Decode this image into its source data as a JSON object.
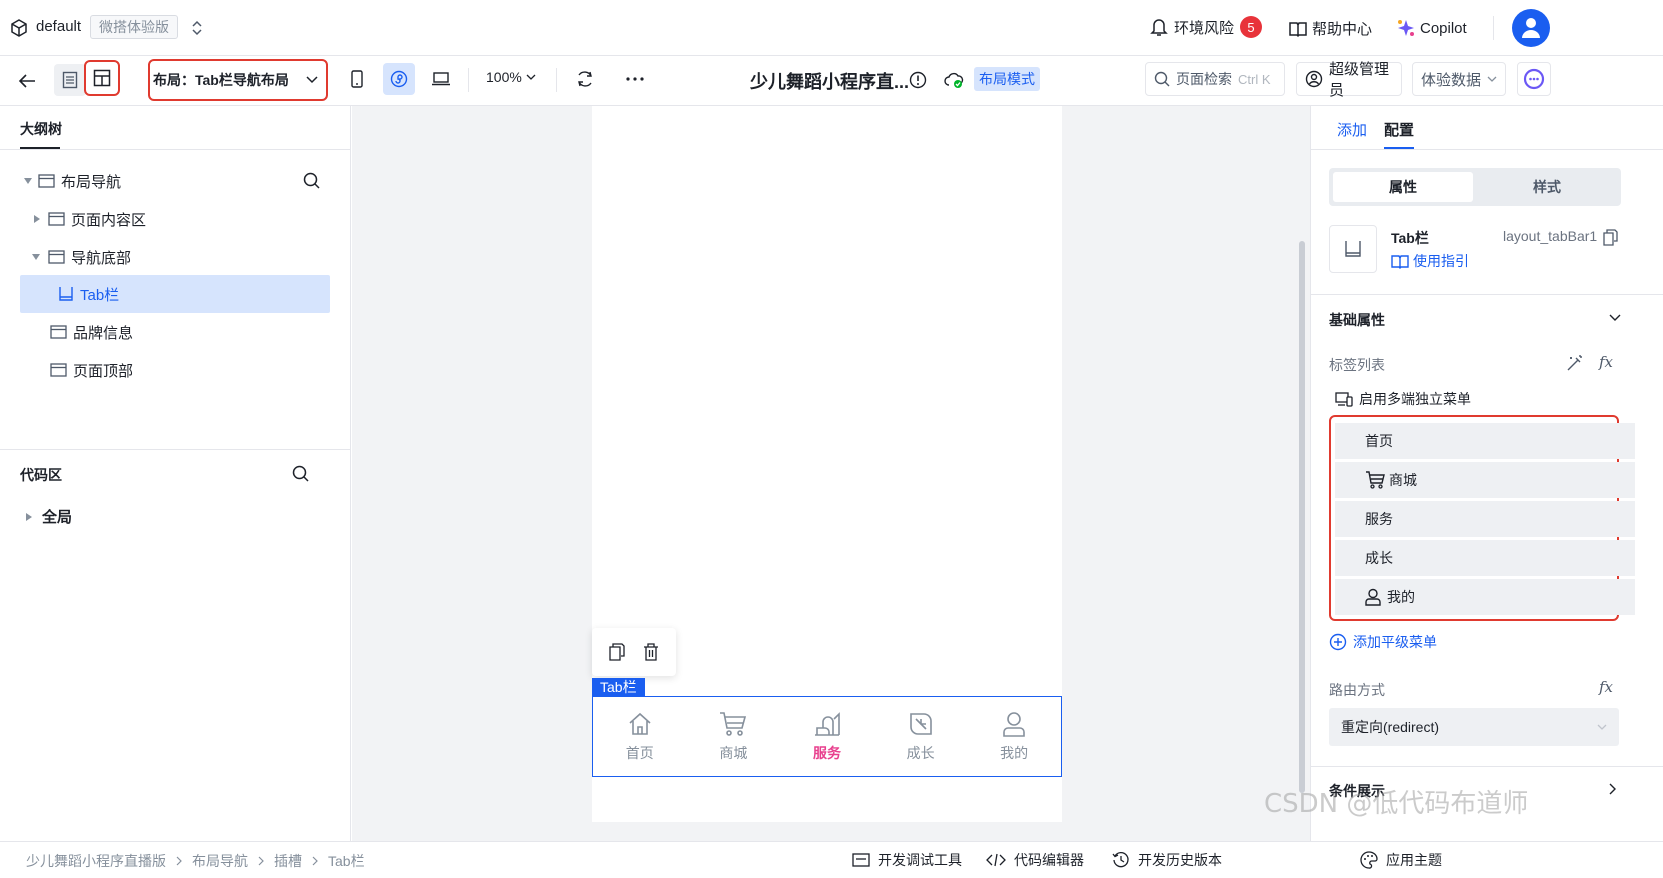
{
  "header": {
    "app_name": "default",
    "edition_badge": "微搭体验版",
    "env_risk_label": "环境风险",
    "env_risk_count": "5",
    "help_label": "帮助中心",
    "copilot_label": "Copilot"
  },
  "toolbar": {
    "layout_select": "布局：Tab栏导航布局",
    "zoom": "100%",
    "page_title": "少儿舞蹈小程序直...",
    "layout_mode_badge": "布局模式",
    "search_label": "页面检索",
    "search_shortcut": "Ctrl K",
    "admin_label": "超级管理员",
    "data_label": "体验数据"
  },
  "outline": {
    "title": "大纲树",
    "items": [
      {
        "label": "布局导航"
      },
      {
        "label": "页面内容区"
      },
      {
        "label": "导航底部"
      },
      {
        "label": "Tab栏"
      },
      {
        "label": "品牌信息"
      },
      {
        "label": "页面顶部"
      }
    ]
  },
  "code_area": {
    "title": "代码区",
    "global_label": "全局"
  },
  "canvas": {
    "selection_tag": "Tab栏",
    "tabs": [
      {
        "label": "首页",
        "icon": "home-icon",
        "active": false
      },
      {
        "label": "商城",
        "icon": "cart-icon",
        "active": false
      },
      {
        "label": "服务",
        "icon": "service-icon",
        "active": true
      },
      {
        "label": "成长",
        "icon": "leaf-icon",
        "active": false
      },
      {
        "label": "我的",
        "icon": "user-icon",
        "active": false
      }
    ],
    "active_color": "#e8408e",
    "inactive_color": "#86909c"
  },
  "right_panel": {
    "tabs": [
      "添加",
      "配置"
    ],
    "segments": [
      "属性",
      "样式"
    ],
    "component_name": "Tab栏",
    "component_id": "layout_tabBar1",
    "guide_link": "使用指引",
    "section_basic": "基础属性",
    "tag_list_label": "标签列表",
    "multi_menu_label": "启用多端独立菜单",
    "menu_items": [
      {
        "label": "首页",
        "icon": ""
      },
      {
        "label": "商城",
        "icon": "cart-icon"
      },
      {
        "label": "服务",
        "icon": ""
      },
      {
        "label": "成长",
        "icon": ""
      },
      {
        "label": "我的",
        "icon": "user-icon"
      }
    ],
    "add_menu_label": "添加平级菜单",
    "route_label": "路由方式",
    "route_value": "重定向(redirect)",
    "condition_label": "条件展示"
  },
  "statusbar": {
    "breadcrumb": [
      "少儿舞蹈小程序直播版",
      "布局导航",
      "插槽",
      "Tab栏"
    ],
    "dev_tools": "开发调试工具",
    "code_editor": "代码编辑器",
    "history": "开发历史版本",
    "theme": "应用主题"
  },
  "watermark": "CSDN @低代码布道师",
  "colors": {
    "accent": "#1a5ef0",
    "highlight_red": "#e03a2f",
    "selection_bg": "#d6e4fd"
  }
}
